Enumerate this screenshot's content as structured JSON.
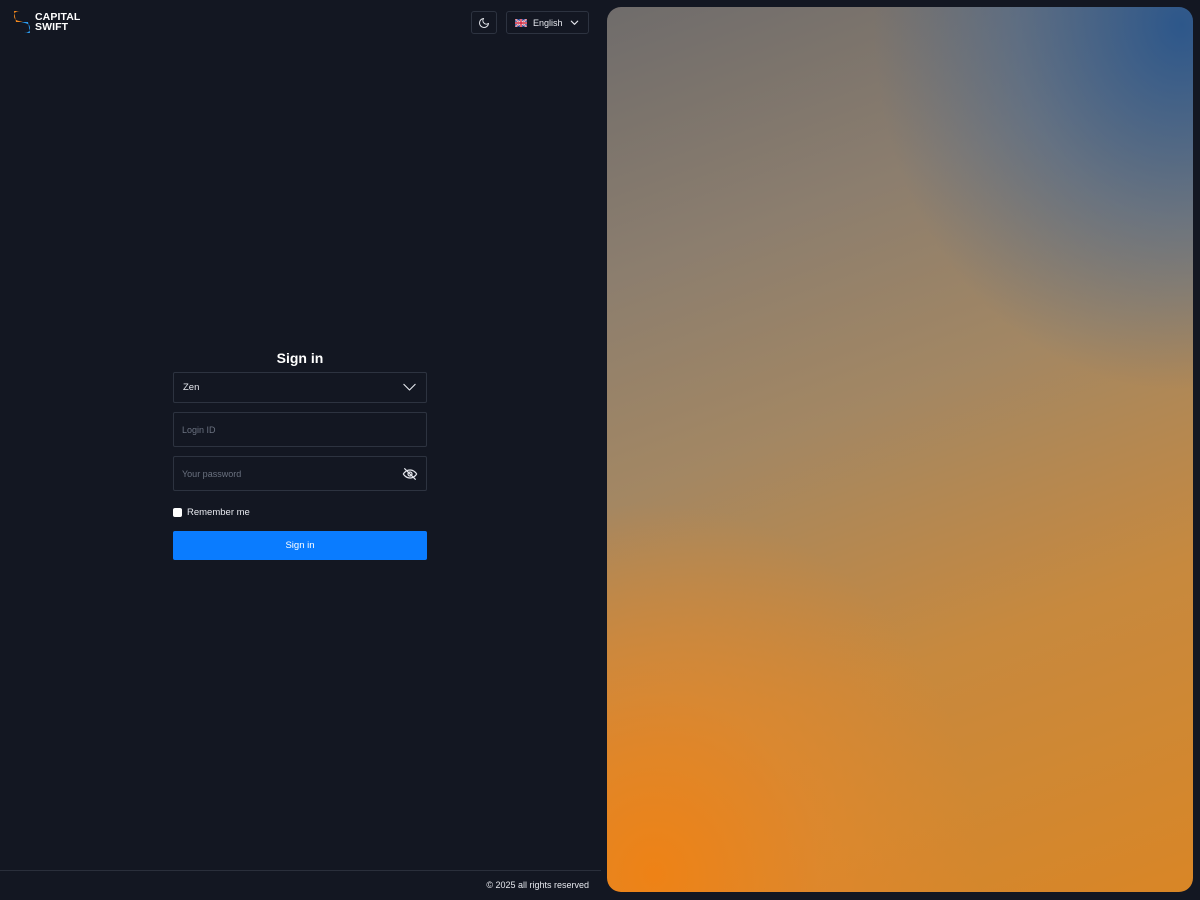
{
  "brand": {
    "line1": "CAPITAL",
    "line2": "SWIFT",
    "colors": {
      "orange": "#f58a1f",
      "blue": "#2b9cf0"
    }
  },
  "header": {
    "theme_icon": "moon-icon",
    "language": {
      "label": "English",
      "flag_icon": "uk-flag-icon",
      "chevron_icon": "chevron-down-icon"
    }
  },
  "signin": {
    "title": "Sign in",
    "server_select": {
      "value": "Zen",
      "icon": "chevron-down-icon"
    },
    "login_id": {
      "placeholder": "Login ID",
      "value": ""
    },
    "password": {
      "placeholder": "Your password",
      "value": "",
      "toggle_icon": "eye-off-icon"
    },
    "remember_label": "Remember me",
    "submit_label": "Sign in"
  },
  "footer": {
    "copyright": "© 2025 all rights reserved"
  },
  "colors": {
    "background": "#131722",
    "border": "#2d3340",
    "primary": "#0a7cff",
    "text": "#e6e8ee"
  }
}
